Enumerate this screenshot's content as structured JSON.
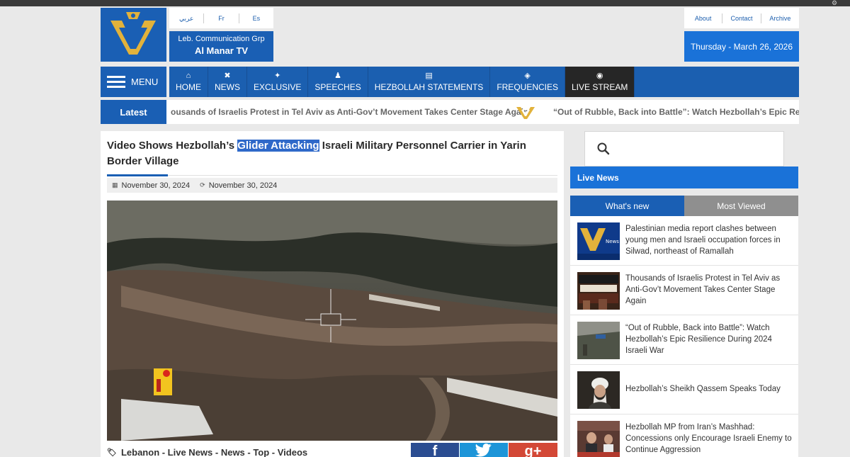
{
  "header": {
    "languages": [
      "عربي",
      "Fr",
      "Es"
    ],
    "brand_sub": "Leb. Communication Grp",
    "brand_name": "Al Manar TV",
    "top_links": [
      "About",
      "Contact",
      "Archive"
    ],
    "date": "Thursday - March 26, 2026"
  },
  "nav": {
    "menu_label": "MENU",
    "items": [
      {
        "label": "HOME",
        "icon": "home-icon"
      },
      {
        "label": "NEWS",
        "icon": "tools-icon"
      },
      {
        "label": "EXCLUSIVE",
        "icon": "star-icon"
      },
      {
        "label": "SPEECHES",
        "icon": "speaker-icon"
      },
      {
        "label": "HEZBOLLAH STATEMENTS",
        "icon": "document-icon"
      },
      {
        "label": "FREQUENCIES",
        "icon": "satellite-icon"
      },
      {
        "label": "LIVE STREAM",
        "icon": "broadcast-icon"
      }
    ]
  },
  "ticker": {
    "label": "Latest",
    "item_a": "ousands of Israelis Protest in Tel Aviv as Anti-Gov’t Movement Takes Center Stage Again",
    "item_b": "“Out of Rubble, Back into Battle”: Watch Hezbollah’s Epic Resilie"
  },
  "article": {
    "title_before": "Video Shows Hezbollah’s ",
    "title_highlight": "Glider Attacking",
    "title_after": " Israeli Military Personnel Carrier in Yarin Border Village",
    "published": "November 30, 2024",
    "updated": "November 30, 2024",
    "tags": [
      "Lebanon",
      "Live News",
      "News",
      "Top",
      "Videos"
    ],
    "tags_text": "Lebanon - Live News - News - Top - Videos",
    "share": {
      "facebook": "f",
      "twitter": "t",
      "google": "g+"
    }
  },
  "sidebar": {
    "live_news": "Live News",
    "tabs": [
      "What's new",
      "Most Viewed"
    ],
    "items": [
      {
        "text": "Palestinian media report clashes between young men and Israeli occupation forces in Silwad, northeast of Ramallah"
      },
      {
        "text": "Thousands of Israelis Protest in Tel Aviv as Anti-Gov’t Movement Takes Center Stage Again"
      },
      {
        "text": "“Out of Rubble, Back into Battle”: Watch Hezbollah’s Epic Resilience During 2024 Israeli War"
      },
      {
        "text": "Hezbollah’s Sheikh Qassem Speaks Today"
      },
      {
        "text": "Hezbollah MP from Iran’s Mashhad: Concessions only Encourage Israeli Enemy to Continue Aggression"
      }
    ]
  },
  "colors": {
    "brand_blue": "#1a5fb4",
    "accent_blue": "#1a72d8",
    "highlight": "#2f69c9"
  }
}
